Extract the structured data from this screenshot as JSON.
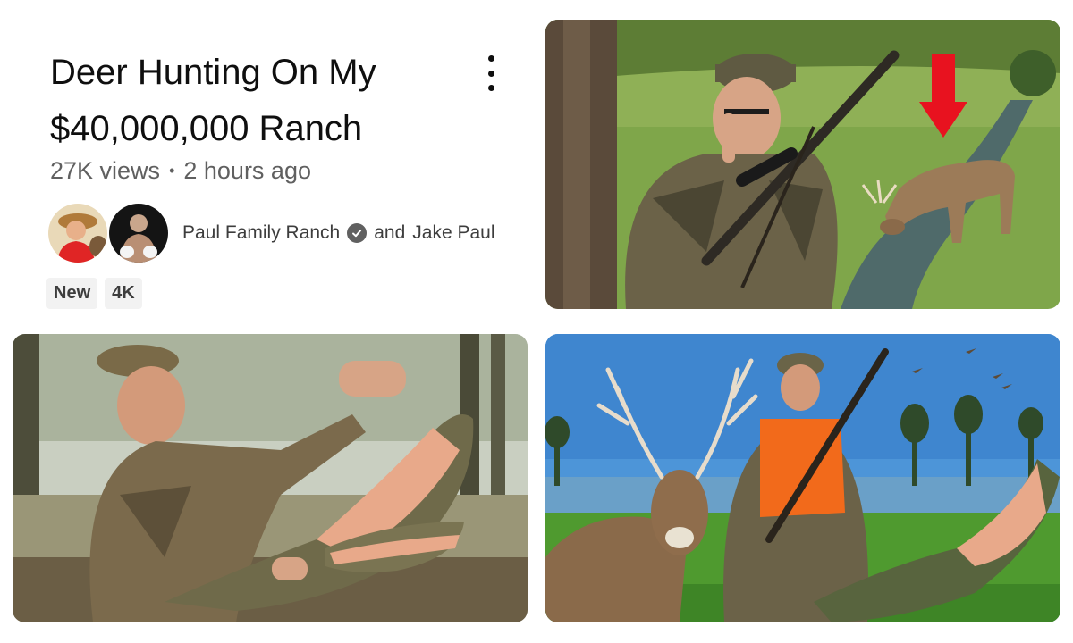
{
  "video": {
    "title": "Deer Hunting On My $40,000,000 Ranch",
    "views": "27K views",
    "separator": "•",
    "posted": "2 hours ago",
    "channel_primary": "Paul Family Ranch",
    "channel_joiner": "and",
    "channel_secondary": "Jake Paul",
    "badges": [
      "New",
      "4K"
    ]
  },
  "thumbnails": [
    {
      "name": "hunter-shushing-deer-thumbnail",
      "icon": "red-arrow-icon"
    },
    {
      "name": "hunter-with-alligator-thumbnail"
    },
    {
      "name": "hunter-with-buck-and-alligator-thumbnail"
    }
  ],
  "colors": {
    "accent_arrow": "#e8121f",
    "orange_vest": "#f26a1b",
    "meta_gray": "#606060",
    "badge_bg": "#f2f2f2"
  }
}
